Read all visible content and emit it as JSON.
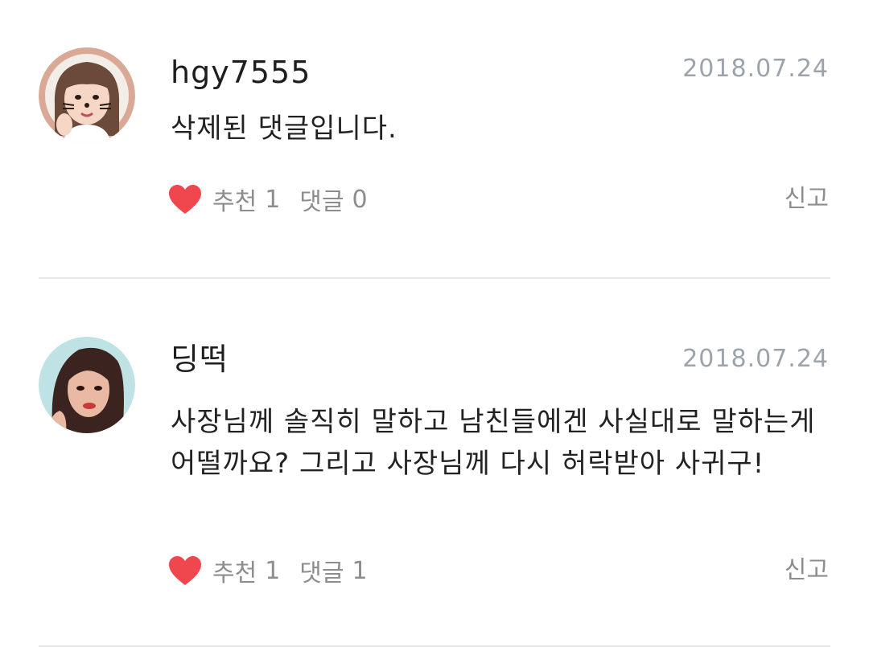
{
  "comments": [
    {
      "username": "hgy7555",
      "date": "2018.07.24",
      "text": "삭제된 댓글입니다.",
      "like_label": "추천",
      "like_count": "1",
      "reply_label": "댓글",
      "reply_count": "0",
      "report_label": "신고",
      "avatar_icon": "user-avatar-photo"
    },
    {
      "username": "딩떡",
      "date": "2018.07.24",
      "text": "사장님께 솔직히 말하고 남친들에겐 사실대로 말하는게 어떨까요? 그리고 사장님께 다시 허락받아 사귀구!",
      "like_label": "추천",
      "like_count": "1",
      "reply_label": "댓글",
      "reply_count": "1",
      "report_label": "신고",
      "avatar_icon": "user-avatar-photo"
    }
  ],
  "colors": {
    "heart": "#f0474f",
    "meta_gray": "#8d8d8d",
    "date_gray": "#9da3ab",
    "divider": "#e6e6e6",
    "avatar1_ring": "#d9a995",
    "avatar2_bg": "#bfe3e4"
  }
}
